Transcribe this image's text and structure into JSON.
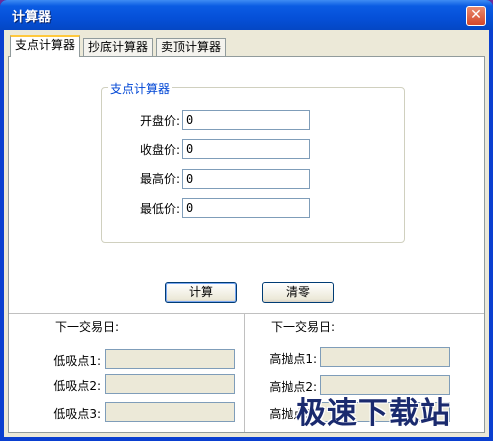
{
  "window": {
    "title": "计算器"
  },
  "tabs": [
    {
      "label": "支点计算器",
      "active": true
    },
    {
      "label": "抄底计算器",
      "active": false
    },
    {
      "label": "卖顶计算器",
      "active": false
    }
  ],
  "pivot": {
    "group_title": "支点计算器",
    "fields": [
      {
        "label": "开盘价:",
        "value": "0"
      },
      {
        "label": "收盘价:",
        "value": "0"
      },
      {
        "label": "最高价:",
        "value": "0"
      },
      {
        "label": "最低价:",
        "value": "0"
      }
    ],
    "calc_label": "计算",
    "clear_label": "清零"
  },
  "results": {
    "left": {
      "title": "下一交易日:",
      "rows": [
        {
          "label": "低吸点1:",
          "value": ""
        },
        {
          "label": "低吸点2:",
          "value": ""
        },
        {
          "label": "低吸点3:",
          "value": ""
        }
      ]
    },
    "right": {
      "title": "下一交易日:",
      "rows": [
        {
          "label": "高抛点1:",
          "value": ""
        },
        {
          "label": "高抛点2:",
          "value": ""
        },
        {
          "label": "高抛点3:",
          "value": ""
        }
      ]
    }
  },
  "watermark": "极速下载站",
  "colors": {
    "titlebar": "#0550d8",
    "accent": "#0046d5",
    "tab_highlight": "#ffc83c"
  }
}
